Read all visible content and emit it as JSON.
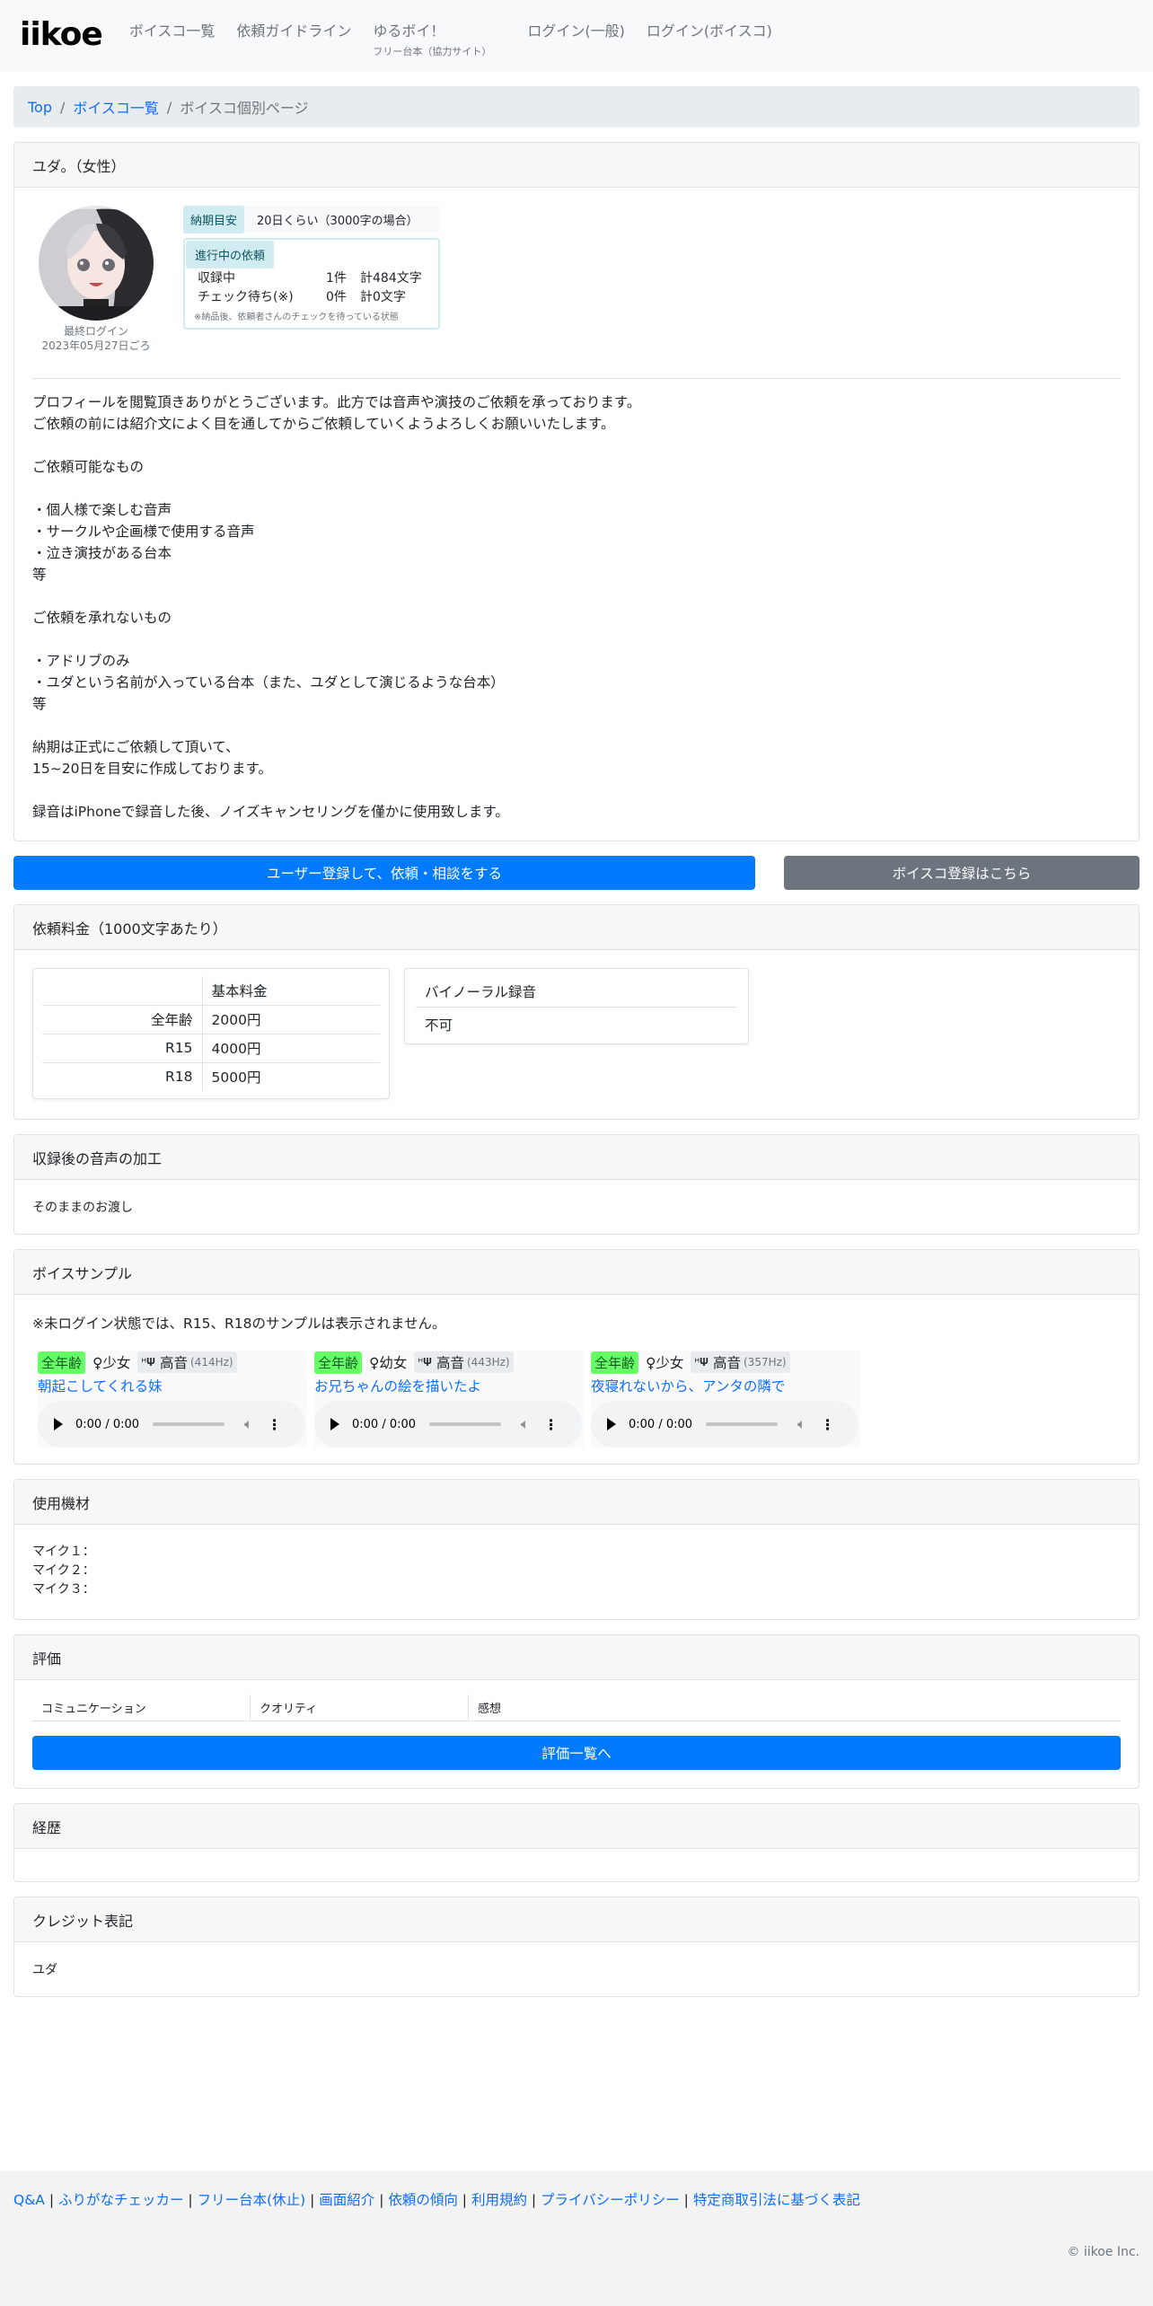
{
  "nav": {
    "brand": "iikoe",
    "items": [
      {
        "label": "ボイスコ一覧"
      },
      {
        "label": "依頼ガイドライン"
      },
      {
        "label": "ゆるボイ！",
        "sub": "フリー台本（協力サイト）"
      },
      {
        "label": "ログイン(一般)"
      },
      {
        "label": "ログイン(ボイスコ)"
      }
    ]
  },
  "breadcrumb": {
    "top": "Top",
    "list": "ボイスコ一覧",
    "current": "ボイスコ個別ページ",
    "sep": "/"
  },
  "profile": {
    "header": "ユダ。（女性）",
    "last_login_label": "最終ログイン",
    "last_login_date": "2023年05月27日ごろ",
    "delivery_label": "納期目安",
    "delivery_value": "20日くらい（3000字の場合）",
    "progress_title": "進行中の依頼",
    "progress_rows": [
      {
        "label": "収録中",
        "count": "1件",
        "chars": "計484文字"
      },
      {
        "label": "チェック待ち(※)",
        "count": "0件",
        "chars": "計0文字"
      }
    ],
    "progress_note": "※納品後、依頼者さんのチェックを待っている状態",
    "description": "プロフィールを閲覧頂きありがとうございます。此方では音声や演技のご依頼を承っております。\nご依頼の前には紹介文によく目を通してからご依頼していくようよろしくお願いいたします。\n\nご依頼可能なもの\n\n・個人様で楽しむ音声\n・サークルや企画様で使用する音声\n・泣き演技がある台本\n等\n\nご依頼を承れないもの\n\n・アドリブのみ\n・ユダという名前が入っている台本（また、ユダとして演じるような台本）\n等\n\n納期は正式にご依頼して頂いて、\n15~20日を目安に作成しております。\n\n録音はiPhoneで録音した後、ノイズキャンセリングを僅かに使用致します。"
  },
  "buttons": {
    "register_user": "ユーザー登録して、依頼・相談をする",
    "register_voice": "ボイスコ登録はこちら"
  },
  "fees": {
    "header": "依頼料金（1000文字あたり）",
    "col_header": "基本料金",
    "rows": [
      {
        "label": "全年齢",
        "value": "2000円"
      },
      {
        "label": "R15",
        "value": "4000円"
      },
      {
        "label": "R18",
        "value": "5000円"
      }
    ],
    "binaural_label": "バイノーラル録音",
    "binaural_value": "不可"
  },
  "processing": {
    "header": "収録後の音声の加工",
    "value": "そのままのお渡し"
  },
  "samples": {
    "header": "ボイスサンプル",
    "note": "※未ログイン状態では、R15、R18のサンプルは表示されません。",
    "items": [
      {
        "rating": "全年齢",
        "age": "♀少女",
        "pitch": "高音",
        "hz": "(414Hz)",
        "title": "朝起こしてくれる妹",
        "time": "0:00 / 0:00"
      },
      {
        "rating": "全年齢",
        "age": "♀幼女",
        "pitch": "高音",
        "hz": "(443Hz)",
        "title": "お兄ちゃんの絵を描いたよ",
        "time": "0:00 / 0:00"
      },
      {
        "rating": "全年齢",
        "age": "♀少女",
        "pitch": "高音",
        "hz": "(357Hz)",
        "title": "夜寝れないから、アンタの隣で",
        "time": "0:00 / 0:00"
      }
    ]
  },
  "equipment": {
    "header": "使用機材",
    "items": [
      "マイク１：",
      "マイク２：",
      "マイク３："
    ]
  },
  "reviews": {
    "header": "評価",
    "columns": [
      "コミュニケーション",
      "クオリティ",
      "感想"
    ],
    "button": "評価一覧へ"
  },
  "history": {
    "header": "経歴"
  },
  "credit": {
    "header": "クレジット表記",
    "value": "ユダ"
  },
  "footer": {
    "links": [
      "Q&A",
      "ふりがなチェッカー",
      "フリー台本(休止)",
      "画面紹介",
      "依頼の傾向",
      "利用規約",
      "プライバシーポリシー",
      "特定商取引法に基づく表記"
    ],
    "sep": " | ",
    "copyright": "© iikoe Inc."
  },
  "icons": {
    "play": "play-icon",
    "volume": "volume-icon",
    "more": "more-vert-icon",
    "pitch": "tuning-fork-icon"
  },
  "colors": {
    "primary": "#007bff",
    "secondary": "#6c757d",
    "rating_green": "#66ff66",
    "link": "#0d6efd"
  }
}
